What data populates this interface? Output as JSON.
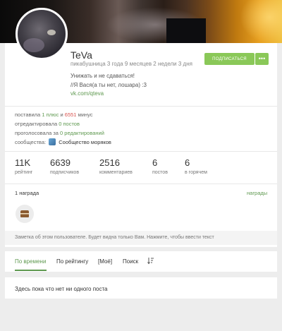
{
  "profile": {
    "username": "TeVa",
    "meta": "пикабушница 3 года 9 месяцев 2 недели 3 дня",
    "bio_line1": "Унижать и не сдаваться!",
    "bio_line2": "//Я Вася(а ты нет, лошара) :3",
    "bio_link": "vk.com/qteva",
    "subscribe_label": "ПОДПИСАТЬСЯ",
    "more_label": "•••"
  },
  "facts": {
    "line1_prefix": "поставила",
    "plus_count": "1 плюс",
    "line1_mid": "и",
    "minus_count": "6551",
    "line1_suffix": "минус",
    "line2_prefix": "отредактировала",
    "edited_posts": "0 постов",
    "line3_prefix": "проголосовала за",
    "edits_voted": "0 редактирований",
    "line4_prefix": "сообщества:",
    "community": "Сообщество моряков"
  },
  "stats": [
    {
      "value": "11K",
      "label": "рейтинг"
    },
    {
      "value": "6639",
      "label": "подписчиков"
    },
    {
      "value": "2516",
      "label": "комментариев"
    },
    {
      "value": "6",
      "label": "постов"
    },
    {
      "value": "6",
      "label": "в горячем"
    }
  ],
  "awards": {
    "title": "1 награда",
    "link": "награды"
  },
  "note": "Заметка об этом пользователе. Будет видна только Вам. Нажмите, чтобы ввести текст",
  "tabs": [
    {
      "label": "По времени",
      "active": true
    },
    {
      "label": "По рейтингу",
      "active": false
    },
    {
      "label": "[Моё]",
      "active": false
    },
    {
      "label": "Поиск",
      "active": false
    }
  ],
  "sort_icon": "sort-icon",
  "empty_text": "Здесь пока что нет ни одного поста",
  "colors": {
    "accent_green": "#8ac858",
    "link_green": "#5f9950",
    "minus_red": "#d9534f",
    "background": "#ededed"
  }
}
